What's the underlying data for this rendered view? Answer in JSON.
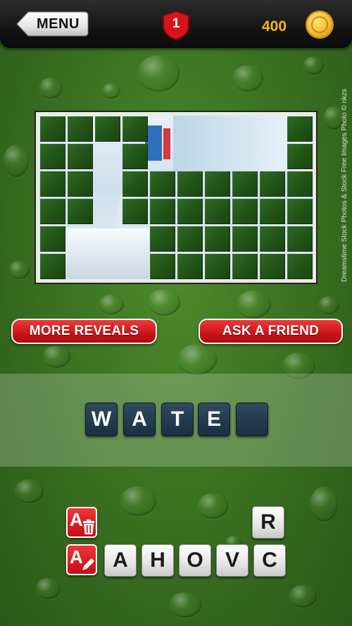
{
  "header": {
    "menu_label": "MENU",
    "level": "1",
    "coins": "400"
  },
  "image_credit": "Dreamstime Stock Photos & Stock Free Images   Photo © nkzs",
  "buttons": {
    "more_reveals": "MORE REVEALS",
    "ask_friend": "ASK A FRIEND"
  },
  "answer": {
    "slots": [
      "W",
      "A",
      "T",
      "E",
      ""
    ]
  },
  "letters": {
    "row1": [
      "R"
    ],
    "row2": [
      "A",
      "H",
      "O",
      "V",
      "C"
    ]
  },
  "tools": {
    "remove_letters_letter": "A",
    "reveal_letter_letter": "A"
  },
  "colors": {
    "accent_red": "#c8141a",
    "coin_gold": "#f2b625",
    "slot_blue": "#1b2f40",
    "background_green": "#3b7322"
  }
}
